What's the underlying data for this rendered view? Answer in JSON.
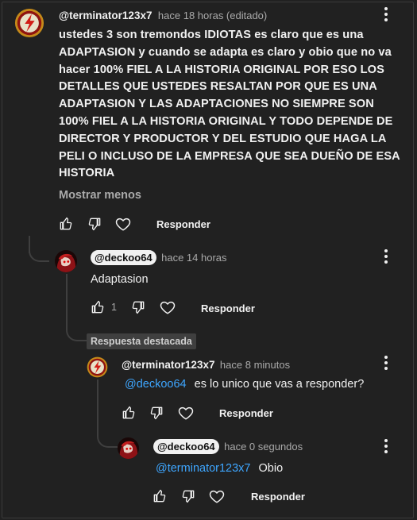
{
  "colors": {
    "background": "#212121",
    "text": "#f1f1f1",
    "secondary": "#aaaaaa",
    "mention": "#3ea6ff",
    "chip_bg": "#f1f1f1"
  },
  "icons": {
    "like": "thumb-up-icon",
    "dislike": "thumb-down-icon",
    "heart": "heart-icon",
    "menu": "more-vert-icon",
    "avatar_flash": "flash-logo-avatar",
    "avatar_user": "red-hair-avatar"
  },
  "comment": {
    "author": "@terminator123x7",
    "meta": "hace 18 horas (editado)",
    "text": "ustedes 3 son tremondos IDIOTAS es claro que es una ADAPTASION y cuando se adapta es claro y obio que no va hacer 100% FIEL A LA HISTORIA ORIGINAL POR ESO LOS DETALLES QUE USTEDES RESALTAN POR QUE ES UNA ADAPTASION Y LAS ADAPTACIONES NO SIEMPRE SON 100% FIEL A LA HISTORIA ORIGINAL  Y TODO DEPENDE DE DIRECTOR Y PRODUCTOR Y DEL ESTUDIO QUE HAGA LA PELI O INCLUSO DE LA EMPRESA QUE SEA DUEÑO DE ESA HISTORIA",
    "show_less": "Mostrar menos",
    "reply_label": "Responder"
  },
  "reply1": {
    "author": "@deckoo64",
    "meta": "hace 14 horas",
    "text": "Adaptasion",
    "likes": "1",
    "reply_label": "Responder"
  },
  "featured_label": "Respuesta destacada",
  "reply2": {
    "author": "@terminator123x7",
    "meta": "hace 8 minutos",
    "mention": "@deckoo64",
    "text": "es lo unico que vas a responder?",
    "reply_label": "Responder"
  },
  "reply3": {
    "author": "@deckoo64",
    "meta": "hace 0 segundos",
    "mention": "@terminator123x7",
    "text": "Obio",
    "reply_label": "Responder"
  }
}
